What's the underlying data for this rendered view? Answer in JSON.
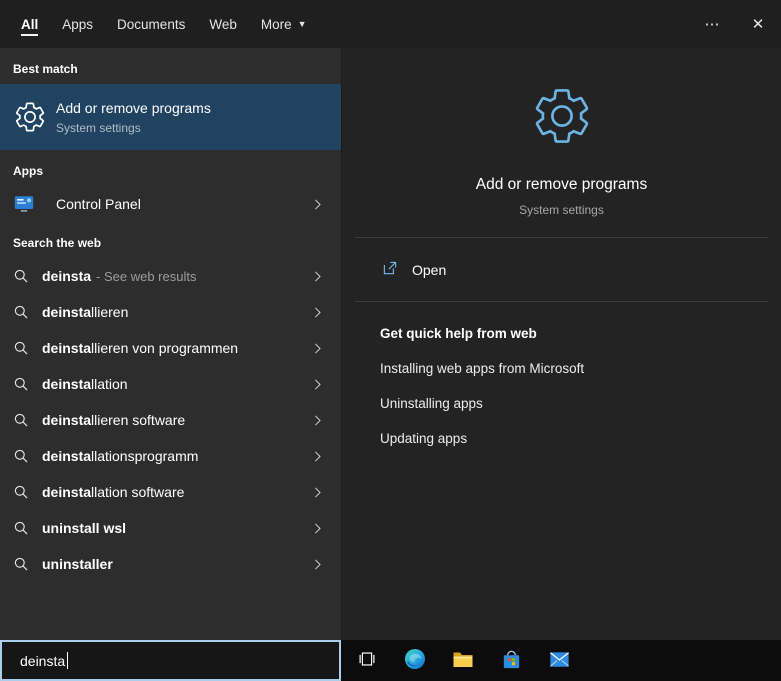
{
  "colors": {
    "best_match_highlight": "#1f4360",
    "gear_blue": "#6cb5e3",
    "searchbox_border": "#a9cdea",
    "panel_left": "#2d2d2d",
    "panel_right": "#232323",
    "taskbar": "#0c0c0c"
  },
  "topbar": {
    "tabs": [
      {
        "label": "All"
      },
      {
        "label": "Apps"
      },
      {
        "label": "Documents"
      },
      {
        "label": "Web"
      },
      {
        "label": "More"
      }
    ],
    "more_arrow": "▼",
    "ellipsis_icon": "⋯",
    "close_icon": "✕"
  },
  "results": {
    "best_match_header": "Best match",
    "best_match": {
      "title": "Add or remove programs",
      "subtitle": "System settings"
    },
    "apps_header": "Apps",
    "apps": [
      {
        "label": "Control Panel"
      }
    ],
    "web_header": "Search the web",
    "web": [
      {
        "query": "deinsta",
        "suffix": "",
        "meta": "- See web results"
      },
      {
        "query": "deinsta",
        "suffix": "llieren"
      },
      {
        "query": "deinsta",
        "suffix": "llieren von programmen"
      },
      {
        "query": "deinsta",
        "suffix": "llation"
      },
      {
        "query": "deinsta",
        "suffix": "llieren software"
      },
      {
        "query": "deinsta",
        "suffix": "llationsprogramm"
      },
      {
        "query": "deinsta",
        "suffix": "llation software"
      },
      {
        "query": "uninstall wsl",
        "suffix": ""
      },
      {
        "query": "uninstaller",
        "suffix": ""
      }
    ]
  },
  "preview": {
    "title": "Add or remove programs",
    "subtitle": "System settings",
    "open_label": "Open",
    "help_header": "Get quick help from web",
    "help_links": [
      "Installing web apps from Microsoft",
      "Uninstalling apps",
      "Updating apps"
    ]
  },
  "search": {
    "value": "deinsta"
  },
  "taskbar": {
    "icons": [
      "task-view",
      "edge",
      "file-explorer",
      "store",
      "mail"
    ]
  }
}
